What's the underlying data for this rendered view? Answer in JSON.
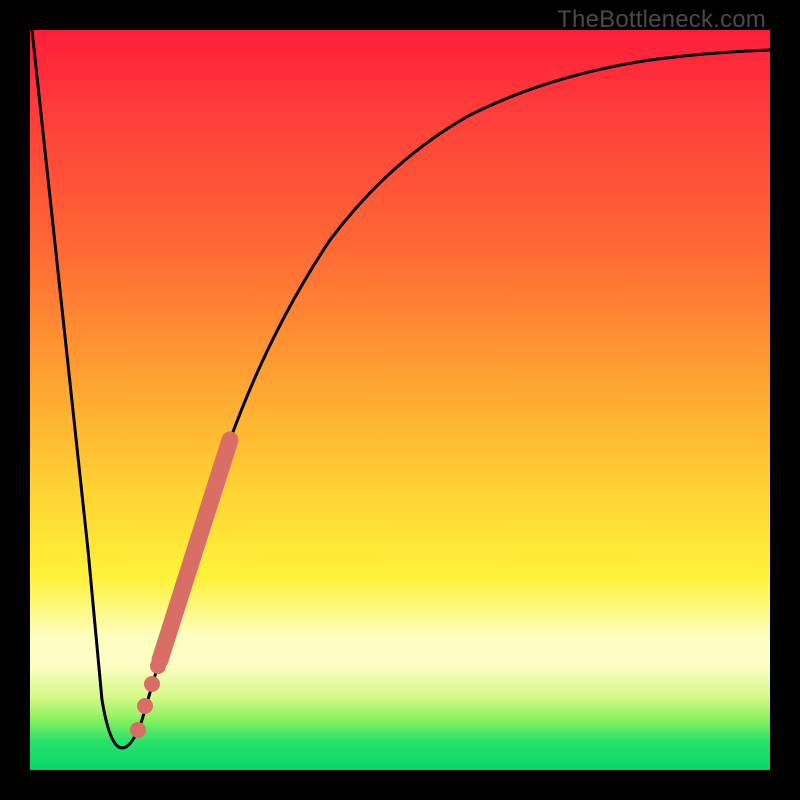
{
  "watermark": "TheBottleneck.com",
  "colors": {
    "frame": "#000000",
    "curve": "#000000",
    "hotspot": "#d86e65",
    "gradient_top": "#ff1d3a",
    "gradient_bottom": "#06d66b"
  },
  "chart_data": {
    "type": "line",
    "title": "",
    "xlabel": "",
    "ylabel": "",
    "xlim": [
      0,
      100
    ],
    "ylim": [
      0,
      100
    ],
    "grid": false,
    "legend": false,
    "annotation": "TheBottleneck.com",
    "series": [
      {
        "name": "bottleneck-curve",
        "x": [
          0,
          5,
          8,
          10,
          11,
          12,
          14,
          16,
          18,
          20,
          24,
          28,
          32,
          36,
          40,
          45,
          50,
          55,
          60,
          65,
          70,
          75,
          80,
          85,
          90,
          95,
          100
        ],
        "y": [
          100,
          50,
          20,
          6,
          3,
          3,
          5,
          10,
          18,
          26,
          40,
          52,
          62,
          70,
          76,
          81,
          85,
          88,
          90,
          92,
          93.5,
          94.5,
          95.3,
          96,
          96.5,
          96.8,
          97
        ]
      }
    ],
    "hotspots": {
      "name": "recommendation-band",
      "segment": {
        "x": [
          13.5,
          23
        ],
        "y": [
          4,
          38
        ]
      },
      "dots": [
        {
          "x": 13.2,
          "y": 3
        },
        {
          "x": 15.0,
          "y": 9
        },
        {
          "x": 16.4,
          "y": 15
        },
        {
          "x": 17.8,
          "y": 21
        }
      ]
    }
  }
}
